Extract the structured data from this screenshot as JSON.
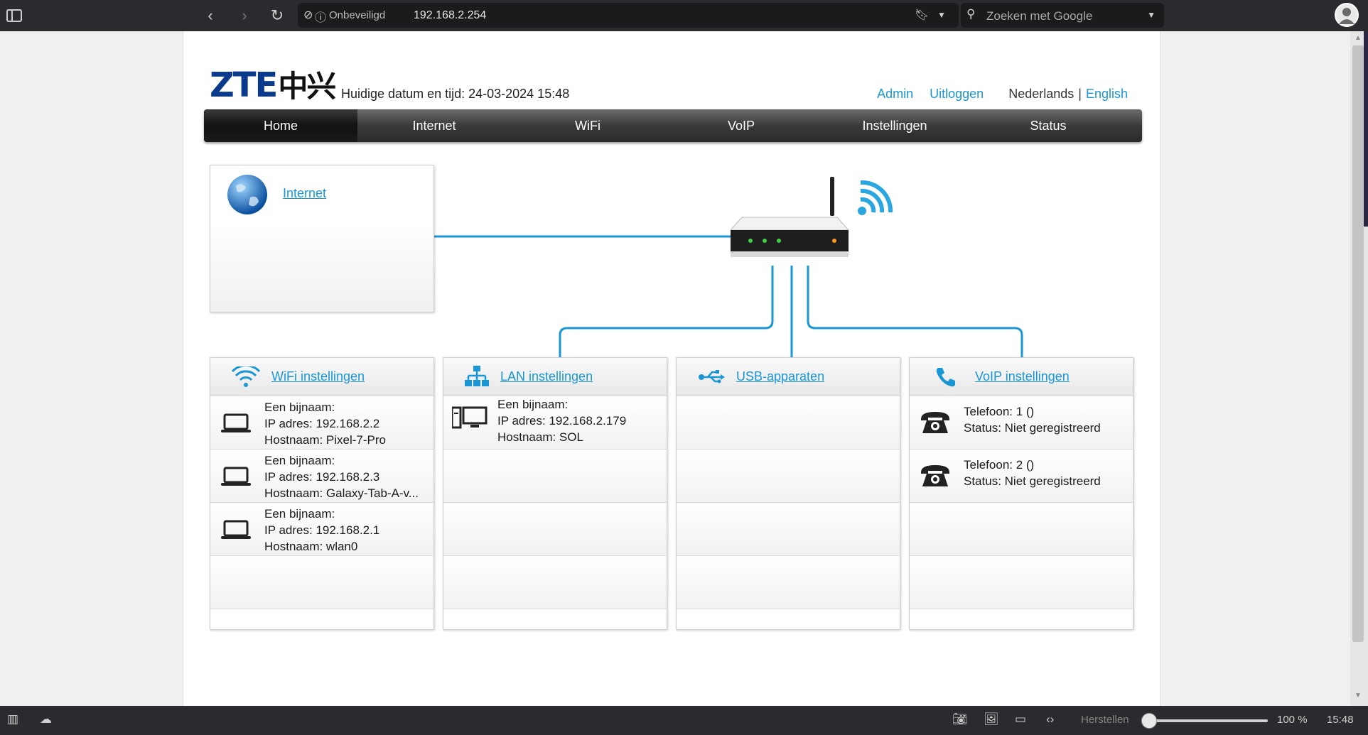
{
  "browser": {
    "security_label": "Onbeveiligd",
    "url": "192.168.2.254",
    "search_placeholder": "Zoeken met Google",
    "zoom_reset_label": "Herstellen",
    "zoom_level": "100 %",
    "clock": "15:48"
  },
  "header": {
    "logo_text": "ZTE",
    "logo_cn": "中兴",
    "datetime": "Huidige datum en tijd: 24-03-2024 15:48",
    "admin_link": "Admin",
    "logout_link": "Uitloggen",
    "lang_nl": "Nederlands",
    "lang_sep": "|",
    "lang_en": "English"
  },
  "nav": {
    "items": [
      "Home",
      "Internet",
      "WiFi",
      "VoIP",
      "Instellingen",
      "Status"
    ],
    "active": "Home"
  },
  "internet_box": {
    "label": "Internet"
  },
  "wifi": {
    "title": "WiFi instellingen",
    "devices": [
      {
        "alias": "Een bijnaam:",
        "ip": "IP adres: 192.168.2.2",
        "host": "Hostnaam: Pixel-7-Pro"
      },
      {
        "alias": "Een bijnaam:",
        "ip": "IP adres: 192.168.2.3",
        "host": "Hostnaam: Galaxy-Tab-A-v..."
      },
      {
        "alias": "Een bijnaam:",
        "ip": "IP adres: 192.168.2.1",
        "host": "Hostnaam: wlan0"
      }
    ]
  },
  "lan": {
    "title": "LAN instellingen",
    "devices": [
      {
        "alias": "Een bijnaam:",
        "ip": "IP adres: 192.168.2.179",
        "host": "Hostnaam: SOL"
      }
    ]
  },
  "usb": {
    "title": "USB-apparaten"
  },
  "voip": {
    "title": "VoIP instellingen",
    "lines": [
      {
        "phone": "Telefoon: 1 ()",
        "status": "Status: Niet geregistreerd"
      },
      {
        "phone": "Telefoon: 2 ()",
        "status": "Status: Niet geregistreerd"
      }
    ]
  },
  "colors": {
    "link": "#1a96d4",
    "logo": "#0a3a8c",
    "line": "#1a96d4"
  }
}
